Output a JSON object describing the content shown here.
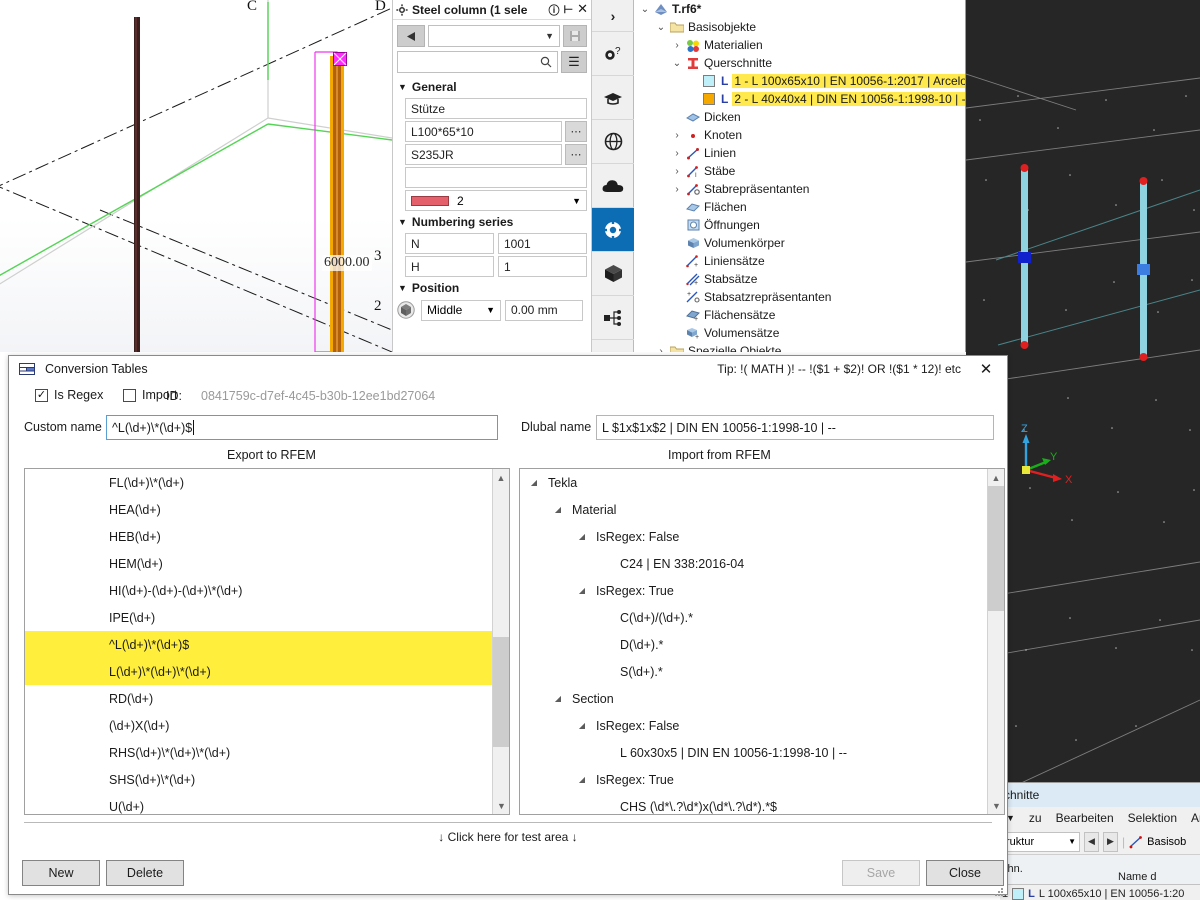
{
  "background": {
    "viewport_left": {
      "dimension_label": "6000.00",
      "axis_labels": [
        "C",
        "D",
        "3",
        "2"
      ]
    },
    "property_panel": {
      "title": "Steel column (1 sele",
      "icons": [
        "gear-icon",
        "help-icon",
        "collapse-icon",
        "close-icon"
      ],
      "preset_combo_value": "",
      "search_placeholder": "",
      "sections": [
        {
          "name": "General",
          "fields": [
            {
              "value": "Stütze",
              "has_ellipsis": false
            },
            {
              "value": "L100*65*10",
              "has_ellipsis": true
            },
            {
              "value": "S235JR",
              "has_ellipsis": true
            },
            {
              "value": "",
              "has_ellipsis": false
            }
          ],
          "color_value": "2",
          "color_hex": "#e4616b"
        },
        {
          "name": "Numbering series",
          "rows": [
            {
              "label": "N",
              "value": "1001"
            },
            {
              "label": "H",
              "value": "1"
            }
          ]
        },
        {
          "name": "Position",
          "align_value": "Middle",
          "offset_value": "0.00 mm"
        }
      ],
      "rail_icons": [
        "chevron-right-icon",
        "settings-help-icon",
        "graduation-cap-icon",
        "globe-icon",
        "cloud-icon",
        "gear-icon",
        "cube-icon",
        "hierarchy-icon",
        "shapes-icon"
      ],
      "rail_active_index": 5
    },
    "navigator_tree": {
      "root": "T.rf6*",
      "items": [
        {
          "label": "T.rf6*",
          "depth": 0,
          "chevron": "v",
          "icon": "model-icon",
          "bold": true,
          "highlight": false
        },
        {
          "label": "Basisobjekte",
          "depth": 1,
          "chevron": "v",
          "icon": "folder-icon",
          "bold": false,
          "highlight": false
        },
        {
          "label": "Materialien",
          "depth": 2,
          "chevron": ">",
          "icon": "materials-icon",
          "bold": false,
          "highlight": false
        },
        {
          "label": "Querschnitte",
          "depth": 2,
          "chevron": "v",
          "icon": "section-icon",
          "bold": false,
          "highlight": false
        },
        {
          "label": "1 - L 100x65x10 | EN 10056-1:2017 | Arcelo",
          "depth": 3,
          "chevron": "",
          "icon": "swatch-cyan",
          "bold": false,
          "highlight": true,
          "swatch": "#bff0fa",
          "prefix": "L"
        },
        {
          "label": "2 - L 40x40x4 | DIN EN 10056-1:1998-10 | --",
          "depth": 3,
          "chevron": "",
          "icon": "swatch-orange",
          "bold": false,
          "highlight": true,
          "swatch": "#f5a800",
          "prefix": "L"
        },
        {
          "label": "Dicken",
          "depth": 2,
          "chevron": "",
          "icon": "thickness-icon",
          "bold": false,
          "highlight": false
        },
        {
          "label": "Knoten",
          "depth": 2,
          "chevron": ">",
          "icon": "node-icon",
          "bold": false,
          "highlight": false
        },
        {
          "label": "Linien",
          "depth": 2,
          "chevron": ">",
          "icon": "line-icon",
          "bold": false,
          "highlight": false
        },
        {
          "label": "Stäbe",
          "depth": 2,
          "chevron": ">",
          "icon": "member-icon",
          "bold": false,
          "highlight": false
        },
        {
          "label": "Stabrepräsentanten",
          "depth": 2,
          "chevron": ">",
          "icon": "member-rep-icon",
          "bold": false,
          "highlight": false
        },
        {
          "label": "Flächen",
          "depth": 2,
          "chevron": "",
          "icon": "surface-icon",
          "bold": false,
          "highlight": false
        },
        {
          "label": "Öffnungen",
          "depth": 2,
          "chevron": "",
          "icon": "opening-icon",
          "bold": false,
          "highlight": false
        },
        {
          "label": "Volumenkörper",
          "depth": 2,
          "chevron": "",
          "icon": "solid-icon",
          "bold": false,
          "highlight": false
        },
        {
          "label": "Liniensätze",
          "depth": 2,
          "chevron": "",
          "icon": "line-set-icon",
          "bold": false,
          "highlight": false
        },
        {
          "label": "Stabsätze",
          "depth": 2,
          "chevron": "",
          "icon": "member-set-icon",
          "bold": false,
          "highlight": false
        },
        {
          "label": "Stabsatzrepräsentanten",
          "depth": 2,
          "chevron": "",
          "icon": "member-set-rep-icon",
          "bold": false,
          "highlight": false
        },
        {
          "label": "Flächensätze",
          "depth": 2,
          "chevron": "",
          "icon": "surface-set-icon",
          "bold": false,
          "highlight": false
        },
        {
          "label": "Volumensätze",
          "depth": 2,
          "chevron": "",
          "icon": "solid-set-icon",
          "bold": false,
          "highlight": false
        },
        {
          "label": "Spezielle Objekte",
          "depth": 1,
          "chevron": ">",
          "icon": "folder-icon",
          "bold": false,
          "highlight": false
        }
      ]
    },
    "rfem_fragment": {
      "title": "chnitte",
      "menu": [
        "zu",
        "Bearbeiten",
        "Selektion",
        "Ansich"
      ],
      "combo_value": "ruktur",
      "toolbar_label": "Basisob",
      "col_a": "chn.",
      "col_b": "Name d"
    }
  },
  "dialog": {
    "title": "Conversion Tables",
    "icon": "table-icon",
    "tip": "Tip: !( MATH )! -- !($1 + $2)! OR !($1 * 12)! etc",
    "close_label": "✕",
    "is_regex_label": "Is Regex",
    "is_regex_checked": true,
    "import_label": "Import",
    "import_checked": false,
    "id_label": "ID:",
    "id_value": "0841759c-d7ef-4c45-b30b-12ee1bd27064",
    "source_combo": "Tekla",
    "category_combo": "Section",
    "custom_name_label": "Custom name",
    "custom_name_value": "^L(\\d+)\\*(\\d+)$",
    "dlubal_name_label": "Dlubal name",
    "dlubal_name_value": "L $1x$1x$2 | DIN EN 10056-1:1998-10 | --",
    "export_header": "Export to RFEM",
    "import_header": "Import from RFEM",
    "export_list": [
      {
        "text": "FL(\\d+)\\*(\\d+)",
        "highlight": false
      },
      {
        "text": "HEA(\\d+)",
        "highlight": false
      },
      {
        "text": "HEB(\\d+)",
        "highlight": false
      },
      {
        "text": "HEM(\\d+)",
        "highlight": false
      },
      {
        "text": "HI(\\d+)-(\\d+)-(\\d+)\\*(\\d+)",
        "highlight": false
      },
      {
        "text": "IPE(\\d+)",
        "highlight": false
      },
      {
        "text": "^L(\\d+)\\*(\\d+)$",
        "highlight": true
      },
      {
        "text": "L(\\d+)\\*(\\d+)\\*(\\d+)",
        "highlight": true
      },
      {
        "text": "RD(\\d+)",
        "highlight": false
      },
      {
        "text": "(\\d+)X(\\d+)",
        "highlight": false
      },
      {
        "text": "RHS(\\d+)\\*(\\d+)\\*(\\d+)",
        "highlight": false
      },
      {
        "text": "SHS(\\d+)\\*(\\d+)",
        "highlight": false
      },
      {
        "text": "U(\\d+)",
        "highlight": false
      }
    ],
    "import_tree": [
      {
        "text": "Tekla",
        "depth": 0,
        "expander": true
      },
      {
        "text": "Material",
        "depth": 1,
        "expander": true
      },
      {
        "text": "IsRegex:    False",
        "depth": 2,
        "expander": true
      },
      {
        "text": "C24 | EN 338:2016-04",
        "depth": 3,
        "expander": false
      },
      {
        "text": "IsRegex:    True",
        "depth": 2,
        "expander": true
      },
      {
        "text": "C(\\d+)/(\\d+).*",
        "depth": 3,
        "expander": false
      },
      {
        "text": "D(\\d+).*",
        "depth": 3,
        "expander": false
      },
      {
        "text": "S(\\d+).*",
        "depth": 3,
        "expander": false
      },
      {
        "text": "Section",
        "depth": 1,
        "expander": true
      },
      {
        "text": "IsRegex:    False",
        "depth": 2,
        "expander": true
      },
      {
        "text": "L 60x30x5 | DIN EN 10056-1:1998-10 | --",
        "depth": 3,
        "expander": false
      },
      {
        "text": "IsRegex:    True",
        "depth": 2,
        "expander": true
      },
      {
        "text": "CHS (\\d*\\.?\\d*)x(\\d*\\.?\\d*).*$",
        "depth": 3,
        "expander": false
      }
    ],
    "test_area_text": "↓ Click here for test area ↓",
    "buttons": {
      "new": "New",
      "delete": "Delete",
      "save": "Save",
      "close": "Close"
    },
    "save_enabled": false
  }
}
